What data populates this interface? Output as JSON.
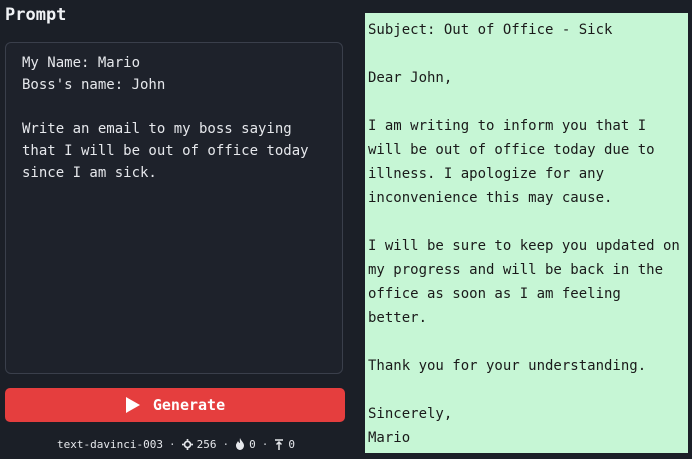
{
  "prompt": {
    "title": "Prompt",
    "text": "My Name: Mario\nBoss's name: John\n\nWrite an email to my boss saying that I will be out of office today since I am sick."
  },
  "generate": {
    "label": "Generate",
    "icon": "play-icon",
    "color": "#e53e3e"
  },
  "status": {
    "model": "text-davinci-003",
    "max_tokens": "256",
    "temperature": "0",
    "top_p": "0",
    "separator": "·"
  },
  "output": {
    "text": "Subject: Out of Office - Sick\n\nDear John,\n\nI am writing to inform you that I will be out of office today due to illness. I apologize for any inconvenience this may cause.\n\nI will be sure to keep you updated on my progress and will be back in the office as soon as I am feeling better.\n\nThank you for your understanding.\n\nSincerely,\nMario",
    "background": "#c6f6d5"
  }
}
